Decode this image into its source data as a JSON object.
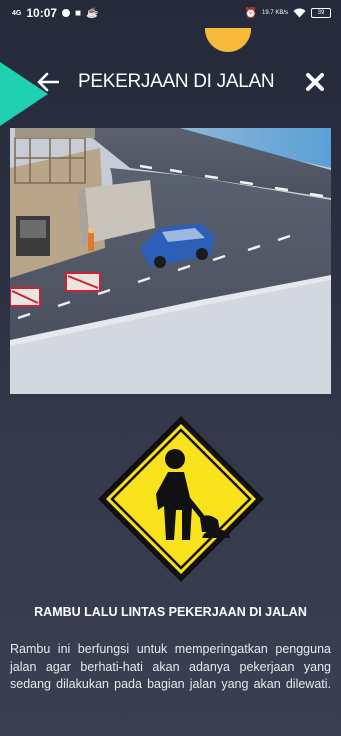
{
  "status_bar": {
    "network": "4G",
    "time": "10:07",
    "net_speed": "19.7 KB/s",
    "battery": "39"
  },
  "header": {
    "title": "PEKERJAAN DI JALAN",
    "back_icon": "arrow-left-icon",
    "close_icon": "close-icon"
  },
  "scene": {
    "description_icon": "road-work-scene"
  },
  "sign": {
    "icon": "road-work-sign-icon"
  },
  "content": {
    "title": "RAMBU LALU LINTAS PEKERJAAN DI JALAN",
    "description": "Rambu ini berfungsi untuk memperingatkan pengguna jalan agar berhati-hati akan adanya pekerjaan yang sedang dilakukan pada bagian jalan yang akan dilewati."
  },
  "colors": {
    "background": "#2c3143",
    "accent_sun": "#f6b93a",
    "accent_teal": "#1fd1b0",
    "sign_yellow": "#f7e21b"
  }
}
